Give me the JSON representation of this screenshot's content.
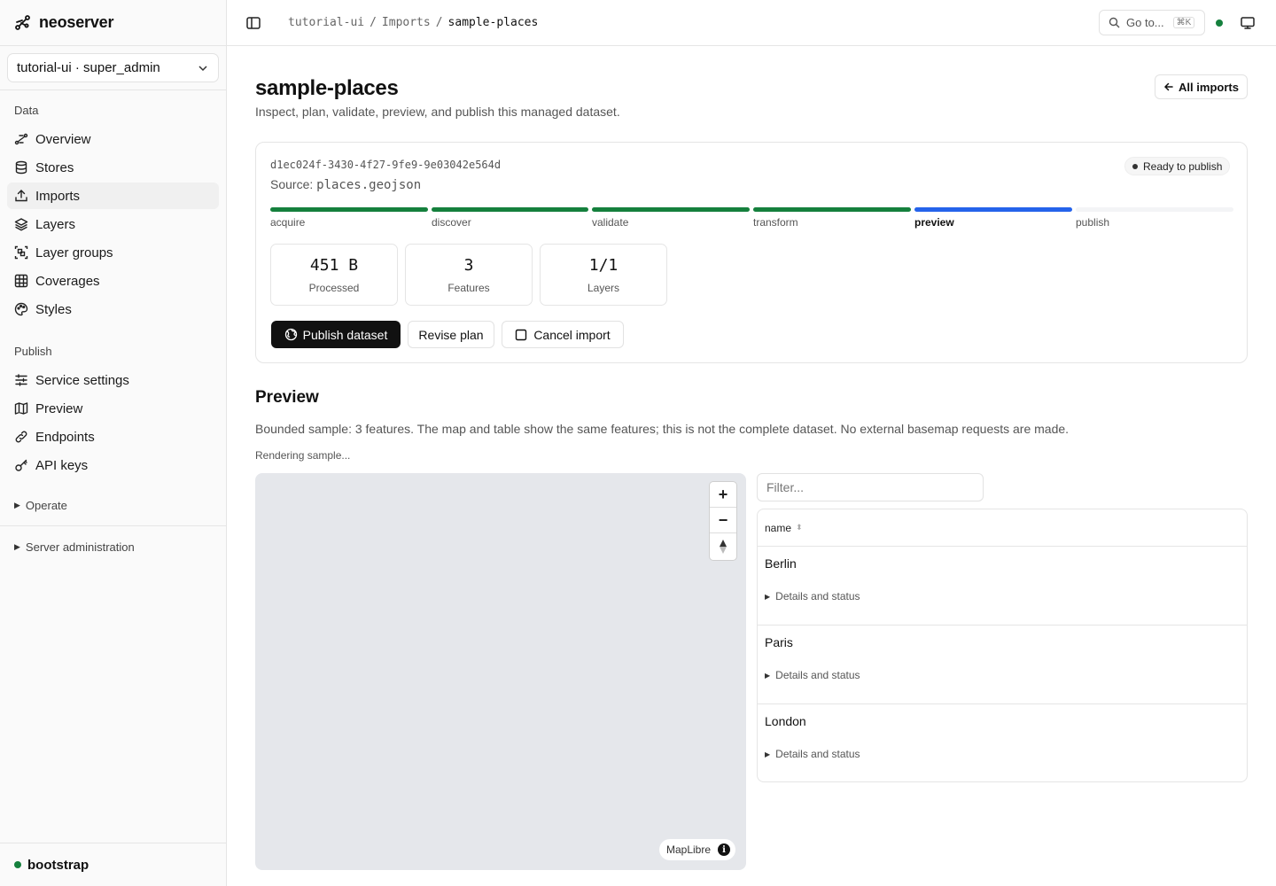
{
  "app": {
    "name": "neoserver"
  },
  "workspace": {
    "label": "tutorial-ui · super_admin"
  },
  "sidebar": {
    "data_label": "Data",
    "data_items": [
      "Overview",
      "Stores",
      "Imports",
      "Layers",
      "Layer groups",
      "Coverages",
      "Styles"
    ],
    "publish_label": "Publish",
    "publish_items": [
      "Service settings",
      "Preview",
      "Endpoints",
      "API keys"
    ],
    "operate_label": "Operate",
    "server_admin_label": "Server administration",
    "footer": "bootstrap"
  },
  "breadcrumb": [
    "tutorial-ui",
    "Imports",
    "sample-places"
  ],
  "topbar": {
    "goto_label": "Go to...",
    "goto_shortcut": "⌘K"
  },
  "page": {
    "title": "sample-places",
    "subtitle": "Inspect, plan, validate, preview, and publish this managed dataset.",
    "all_imports_label": "All imports"
  },
  "import": {
    "id": "d1ec024f-3430-4f27-9fe9-9e03042e564d",
    "source_label": "Source:",
    "source_file": "places.geojson",
    "status": "Ready to publish",
    "steps": [
      "acquire",
      "discover",
      "validate",
      "transform",
      "preview",
      "publish"
    ],
    "current_step": "preview",
    "stats": [
      {
        "value": "451 B",
        "label": "Processed"
      },
      {
        "value": "3",
        "label": "Features"
      },
      {
        "value": "1/1",
        "label": "Layers"
      }
    ],
    "actions": {
      "publish": "Publish dataset",
      "revise": "Revise plan",
      "cancel": "Cancel import"
    }
  },
  "preview": {
    "heading": "Preview",
    "description": "Bounded sample: 3 features. The map and table show the same features; this is not the complete dataset. No external basemap requests are made.",
    "status": "Rendering sample...",
    "map_attribution": "MapLibre",
    "filter_placeholder": "Filter...",
    "column": "name",
    "rows": [
      {
        "name": "Berlin",
        "details": "Details and status"
      },
      {
        "name": "Paris",
        "details": "Details and status"
      },
      {
        "name": "London",
        "details": "Details and status"
      }
    ]
  },
  "colors": {
    "step_done": "#15803d",
    "step_current": "#2563eb",
    "step_pending": "#f3f4f6",
    "status_ok": "#15803d",
    "map_bg": "#e5e7eb"
  }
}
